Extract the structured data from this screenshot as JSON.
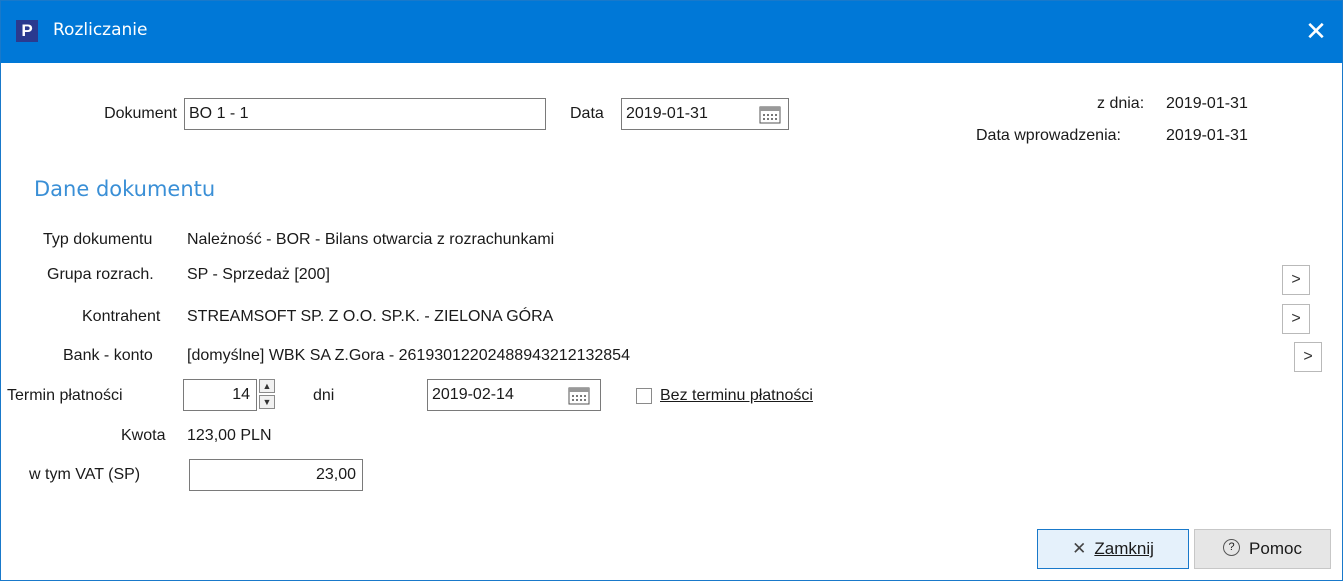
{
  "window": {
    "title": "Rozliczanie",
    "app_icon_letter": "P",
    "close_glyph": "✕"
  },
  "header": {
    "dokument_label": "Dokument",
    "dokument_value": "BO 1 - 1",
    "data_label": "Data",
    "data_value": "2019-01-31",
    "z_dnia_label": "z dnia:",
    "z_dnia_value": "2019-01-31",
    "data_wprow_label": "Data wprowadzenia:",
    "data_wprow_value": "2019-01-31"
  },
  "section": {
    "title": "Dane dokumentu"
  },
  "fields": {
    "typ_label": "Typ dokumentu",
    "typ_value": "Należność  -  BOR  -  Bilans otwarcia z rozrachunkami",
    "grupa_label": "Grupa rozrach.",
    "grupa_value": "SP  -  Sprzedaż [200]",
    "kontrahent_label": "Kontrahent",
    "kontrahent_value": "STREAMSOFT SP. Z O.O. SP.K.  -  ZIELONA GÓRA",
    "bank_label": "Bank - konto",
    "bank_value": "[domyślne] WBK SA Z.Gora - 26193012202488943212132854",
    "termin_label": "Termin płatności",
    "termin_days": "14",
    "dni_label": "dni",
    "termin_date": "2019-02-14",
    "bez_terminu_label": "Bez terminu płatności",
    "kwota_label": "Kwota",
    "kwota_value": "123,00 PLN",
    "vat_label": "w tym VAT (SP)",
    "vat_value": "23,00"
  },
  "buttons": {
    "arrow": ">",
    "zamknij_label": "Zamknij",
    "pomoc_label": "Pomoc"
  },
  "colors": {
    "titlebar": "#0078d7",
    "section": "#3a8fd6",
    "accent_border": "#1979ca"
  }
}
